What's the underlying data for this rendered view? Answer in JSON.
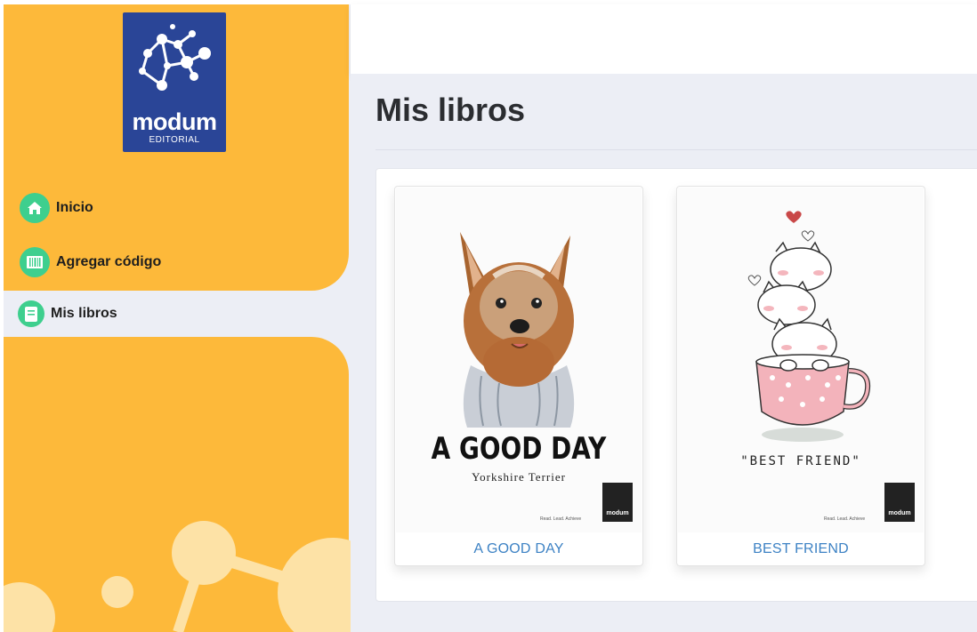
{
  "brand": {
    "name": "modum",
    "sub": "EDITORIAL"
  },
  "sidebar": {
    "items": [
      {
        "label": "Inicio",
        "icon": "home-icon",
        "active": false
      },
      {
        "label": "Agregar código",
        "icon": "barcode-icon",
        "active": false
      },
      {
        "label": "Mis libros",
        "icon": "book-icon",
        "active": true
      }
    ]
  },
  "main": {
    "title": "Mis libros",
    "books": [
      {
        "title": "A GOOD DAY",
        "cover_title": "A GOOD DAY",
        "cover_subtitle": "Yorkshire Terrier",
        "tagline": "Read. Lead. Achieve",
        "publisher": "modum"
      },
      {
        "title": "BEST FRIEND",
        "cover_title": "\"BEST FRIEND\"",
        "tagline": "Read. Lead. Achieve",
        "publisher": "modum"
      }
    ]
  },
  "colors": {
    "sidebar": "#FDB93A",
    "accent_green": "#3ecf8e",
    "logo_blue": "#2a4597",
    "link_blue": "#3d82c4",
    "background": "#eceef5"
  }
}
